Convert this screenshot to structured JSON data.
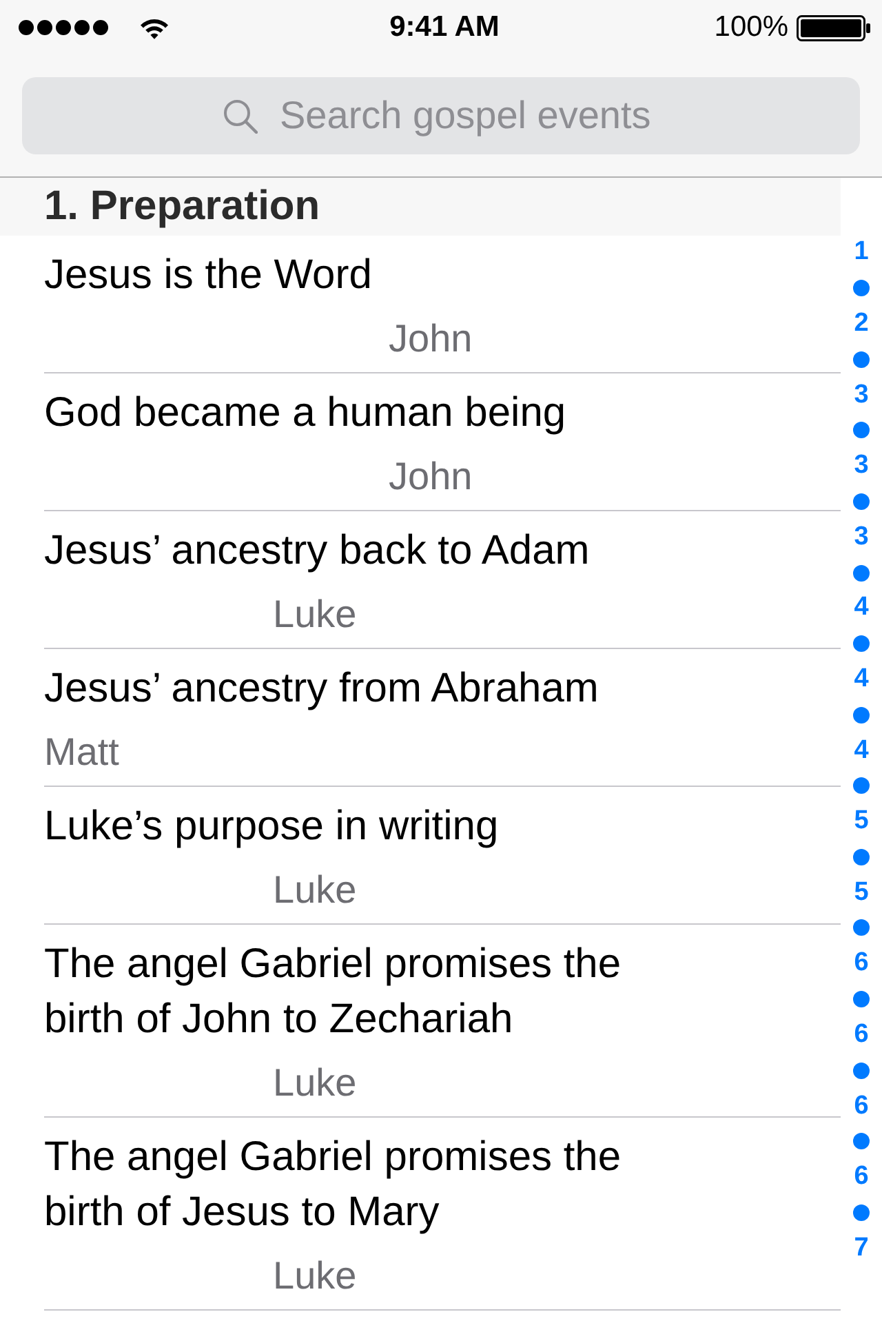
{
  "status_bar": {
    "time": "9:41 AM",
    "battery": "100%"
  },
  "search": {
    "placeholder": "Search gospel events"
  },
  "sections": [
    {
      "title": "1. Preparation",
      "events": [
        {
          "title": "Jesus is the Word",
          "gospel": "John",
          "kind": "john"
        },
        {
          "title": "God became a human being",
          "gospel": "John",
          "kind": "john"
        },
        {
          "title": "Jesus’ ancestry back to Adam",
          "gospel": "Luke",
          "kind": "luke"
        },
        {
          "title": "Jesus’ ancestry from Abraham",
          "gospel": "Matt",
          "kind": "matt"
        },
        {
          "title": "Luke’s purpose in writing",
          "gospel": "Luke",
          "kind": "luke"
        },
        {
          "title": "The angel Gabriel promises the birth of John to Zechariah",
          "gospel": "Luke",
          "kind": "luke"
        },
        {
          "title": "The angel Gabriel promises the birth of Jesus to Mary",
          "gospel": "Luke",
          "kind": "luke"
        }
      ]
    }
  ],
  "index": [
    "1",
    "2",
    "3",
    "3",
    "3",
    "4",
    "4",
    "4",
    "5",
    "5",
    "6",
    "6",
    "6",
    "6",
    "7"
  ]
}
